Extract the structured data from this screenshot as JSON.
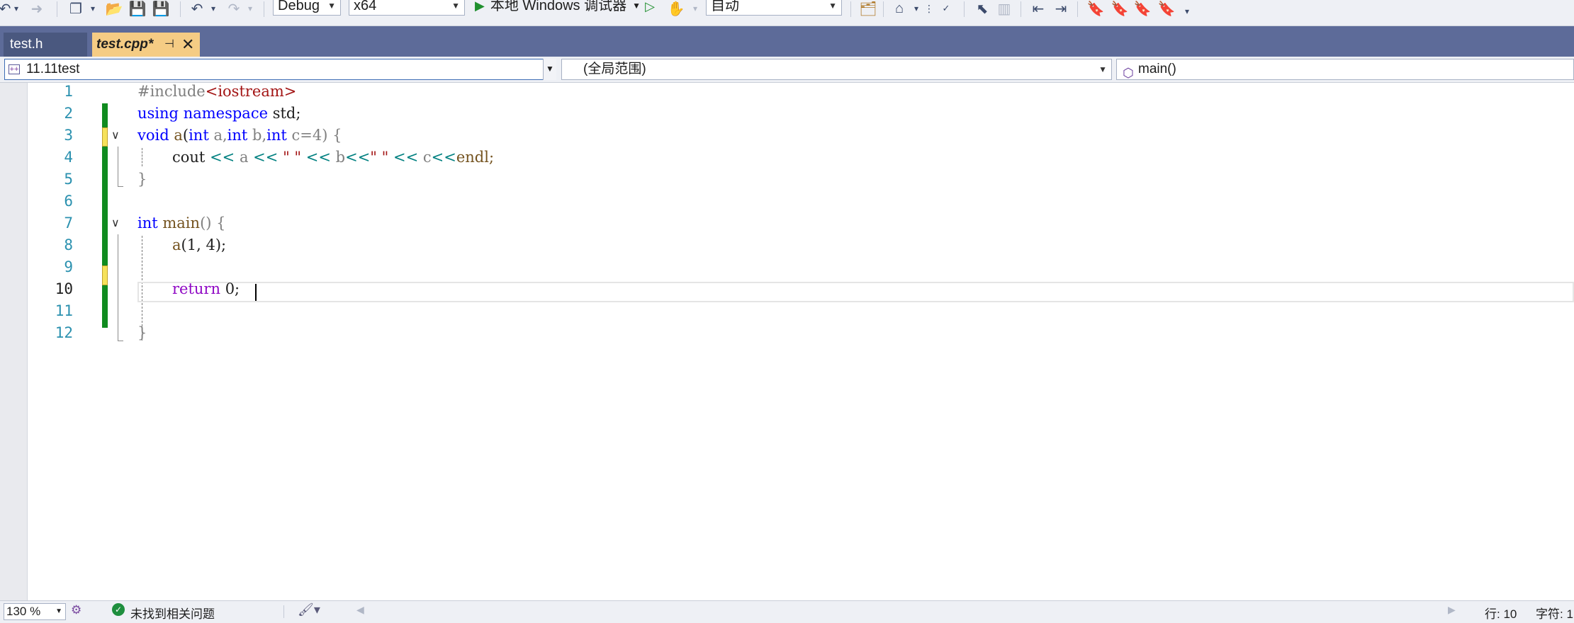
{
  "toolbar": {
    "config": "Debug",
    "platform": "x64",
    "run_label": "本地 Windows 调试器",
    "mode": "自动"
  },
  "tabs": [
    {
      "label": "test.h",
      "active": false
    },
    {
      "label": "test.cpp*",
      "active": true
    }
  ],
  "navbar": {
    "project": "11.11test",
    "scope": "(全局范围)",
    "member": "main()"
  },
  "editor": {
    "line_numbers": [
      "1",
      "2",
      "3",
      "4",
      "5",
      "6",
      "7",
      "8",
      "9",
      "10",
      "11",
      "12"
    ],
    "current_line": 10,
    "tokens": {
      "l1_a": "#include",
      "l1_b": "<iostream>",
      "l2_a": "using",
      "l2_b": "namespace",
      "l2_c": "std;",
      "l3_a": "void",
      "l3_b": "a",
      "l3_c": "(",
      "l3_d": "int",
      "l3_e": "a,",
      "l3_f": "int",
      "l3_g": "b,",
      "l3_h": "int",
      "l3_i": "c=4)",
      "l3_j": "{",
      "l4_a": "cout",
      "l4_b": "<<",
      "l4_c": "a",
      "l4_d": "<<",
      "l4_e": "\" \"",
      "l4_f": "<<",
      "l4_g": "b",
      "l4_h": "<<",
      "l4_i": "\" \"",
      "l4_j": "<<",
      "l4_k": "c",
      "l4_l": "<<",
      "l4_m": "endl;",
      "l5_a": "}",
      "l7_a": "int",
      "l7_b": "main",
      "l7_c": "()",
      "l7_d": "{",
      "l8_a": "a",
      "l8_b": "(1,",
      "l8_c": "4);",
      "l10_a": "return",
      "l10_b": "0;",
      "l12_a": "}"
    }
  },
  "statusbar": {
    "zoom": "130 %",
    "issues": "未找到相关问题",
    "line_pos": "行: 10",
    "char_pos": "字符: 1"
  }
}
